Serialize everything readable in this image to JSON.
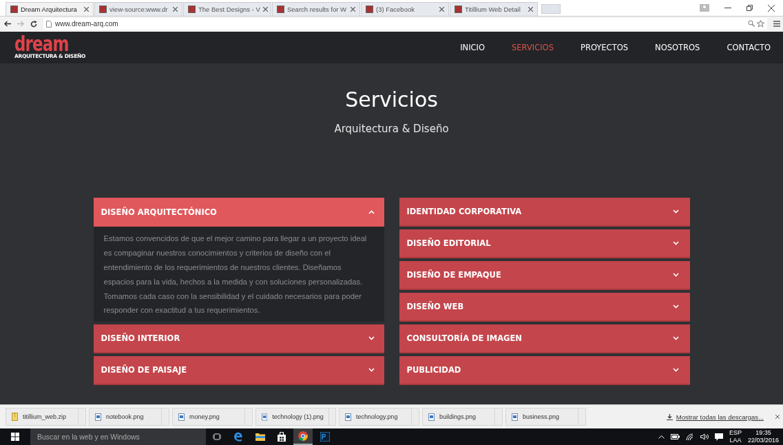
{
  "browser": {
    "tabs": [
      {
        "title": "Dream Arquitectura",
        "selected": true
      },
      {
        "title": "view-source:www.dr",
        "selected": false
      },
      {
        "title": "The Best Designs - V",
        "selected": false
      },
      {
        "title": "Search results for W",
        "selected": false
      },
      {
        "title": "(3) Facebook",
        "selected": false
      },
      {
        "title": "Titillium Web Detail",
        "selected": false
      }
    ],
    "address": "www.dream-arq.com"
  },
  "site": {
    "logo": "dream",
    "logo_tagline": "ARQUITECTURA & DISEÑO",
    "nav": [
      {
        "label": "INICIO",
        "selected": false
      },
      {
        "label": "SERVICIOS",
        "selected": true
      },
      {
        "label": "PROYECTOS",
        "selected": false
      },
      {
        "label": "NOSOTROS",
        "selected": false
      },
      {
        "label": "CONTACTO",
        "selected": false
      }
    ],
    "title": "Servicios",
    "subtitle": "Arquitectura & Diseño",
    "columns": [
      [
        {
          "title": "DISEÑO ARQUITECTÓNICO",
          "expanded": true,
          "body": "Estamos convencidos de que el mejor camino para llegar a un proyecto ideal es compaginar nuestros conocimientos y criterios de diseño con el entendimiento de los requerimientos de nuestros clientes. Diseñamos espacios para la vida, hechos a la medida y con soluciones personalizadas. Tomamos cada caso con la sensibilidad y el cuidado necesarios para poder responder con exactitud a tus requerimientos."
        },
        {
          "title": "DISEÑO INTERIOR",
          "expanded": false
        },
        {
          "title": "DISEÑO DE PAISAJE",
          "expanded": false
        }
      ],
      [
        {
          "title": "IDENTIDAD CORPORATIVA",
          "expanded": false
        },
        {
          "title": "DISEÑO EDITORIAL",
          "expanded": false
        },
        {
          "title": "DISEÑO DE EMPAQUE",
          "expanded": false
        },
        {
          "title": "DISEÑO WEB",
          "expanded": false
        },
        {
          "title": "CONSULTORÍA DE IMAGEN",
          "expanded": false
        },
        {
          "title": "PUBLICIDAD",
          "expanded": false
        }
      ]
    ]
  },
  "downloads": {
    "files": [
      {
        "name": "titillium_web.zip",
        "kind": "zip"
      },
      {
        "name": "notebook.png",
        "kind": "image"
      },
      {
        "name": "money.png",
        "kind": "image"
      },
      {
        "name": "technology (1).png",
        "kind": "image"
      },
      {
        "name": "technology.png",
        "kind": "image"
      },
      {
        "name": "buildings.png",
        "kind": "image"
      },
      {
        "name": "business.png",
        "kind": "image"
      }
    ],
    "show_all": "Mostrar todas las descargas..."
  },
  "taskbar": {
    "search_placeholder": "Buscar en la web y en Windows",
    "language": "ESP",
    "layout": "LAA",
    "time": "19:35",
    "date": "22/03/2016"
  }
}
